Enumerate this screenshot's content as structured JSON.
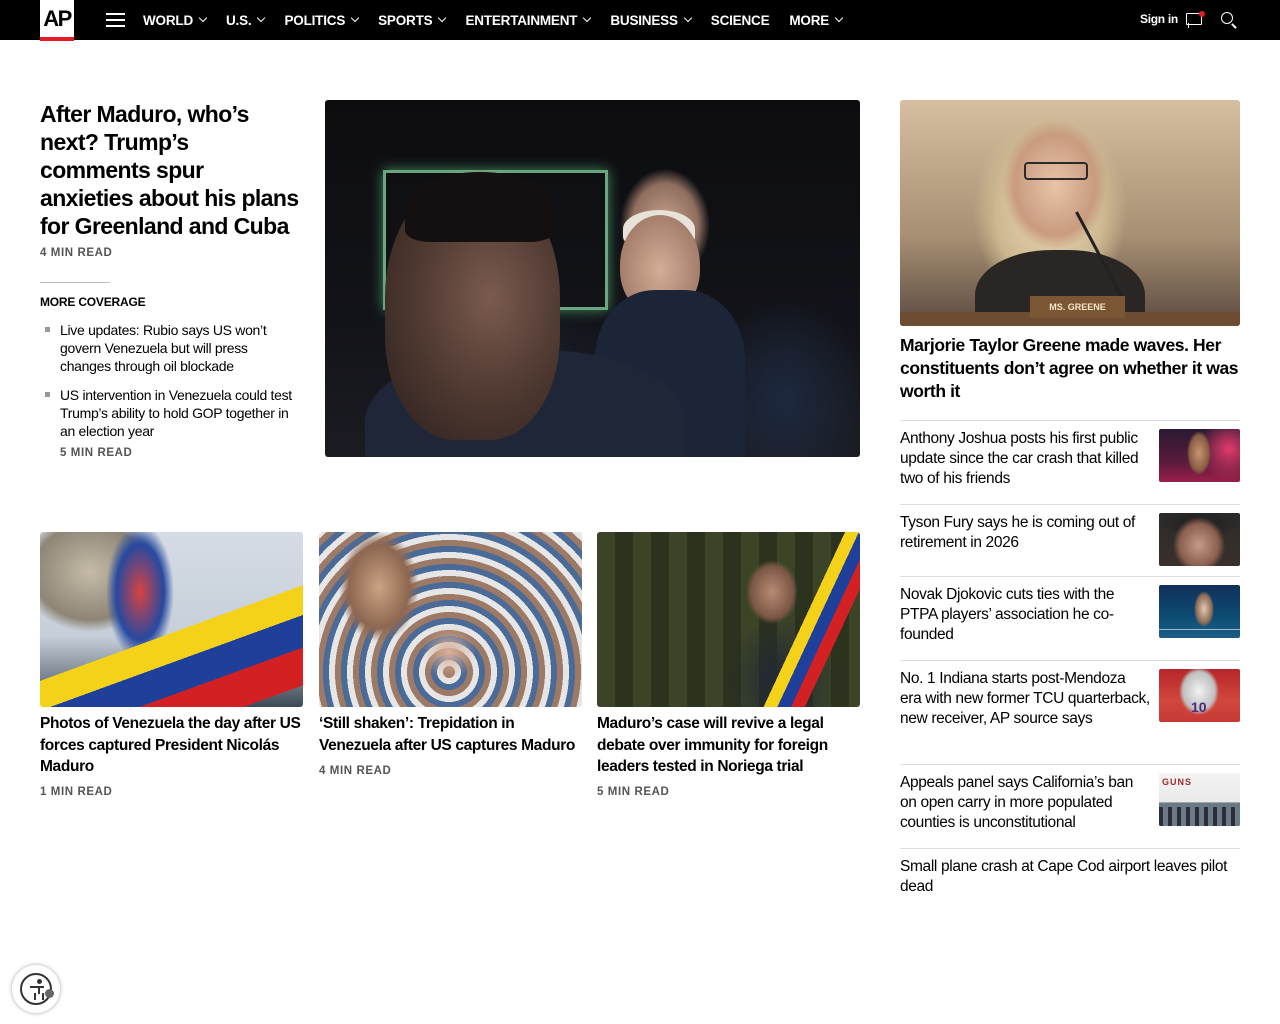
{
  "header": {
    "logo": "AP",
    "nav": [
      {
        "label": "WORLD",
        "dropdown": true
      },
      {
        "label": "U.S.",
        "dropdown": true
      },
      {
        "label": "POLITICS",
        "dropdown": true
      },
      {
        "label": "SPORTS",
        "dropdown": true
      },
      {
        "label": "ENTERTAINMENT",
        "dropdown": true
      },
      {
        "label": "BUSINESS",
        "dropdown": true
      },
      {
        "label": "SCIENCE",
        "dropdown": false
      },
      {
        "label": "MORE",
        "dropdown": true
      }
    ],
    "signin": "Sign in",
    "icons": [
      "menu-icon",
      "chat-icon",
      "search-icon"
    ],
    "accent_color": "#e31b23"
  },
  "lead": {
    "title": "After Maduro, who’s next? Trump’s comments spur anxieties about his plans for Greenland and Cuba",
    "read_time": "4 MIN READ",
    "more_coverage_label": "MORE COVERAGE",
    "coverage": [
      {
        "title": "Live updates: Rubio says US won’t govern Venezuela but will press changes through oil blockade"
      },
      {
        "title": "US intervention in Venezuela could test Trump’s ability to hold GOP together in an election year",
        "read_time": "5 MIN READ"
      }
    ]
  },
  "feature_right": {
    "title": "Marjorie Taylor Greene made waves. Her constituents don’t agree on whether it was worth it",
    "nameplate": "MS. GREENE"
  },
  "side_list": [
    {
      "title": "Anthony Joshua posts his first public update since the car crash that killed two of his friends"
    },
    {
      "title": "Tyson Fury says he is coming out of retirement in 2026"
    },
    {
      "title": "Novak Djokovic cuts ties with the PTPA players’ association he co-founded"
    },
    {
      "title": "No. 1 Indiana starts post-Mendoza era with new former TCU quarterback, new receiver, AP source says"
    },
    {
      "title": "Appeals panel says California’s ban on open carry in more populated counties is unconstitutional"
    },
    {
      "title": "Small plane crash at Cape Cod airport leaves pilot dead"
    }
  ],
  "row": [
    {
      "title": "Photos of Venezuela the day after US forces captured President Nicolás Maduro",
      "read_time": "1 MIN READ"
    },
    {
      "title": "‘Still shaken’: Trepidation in Venezuela after US captures Maduro",
      "read_time": "4 MIN READ"
    },
    {
      "title": "Maduro’s case will revive a legal debate over immunity for foreign leaders tested in Noriega trial",
      "read_time": "5 MIN READ"
    }
  ]
}
